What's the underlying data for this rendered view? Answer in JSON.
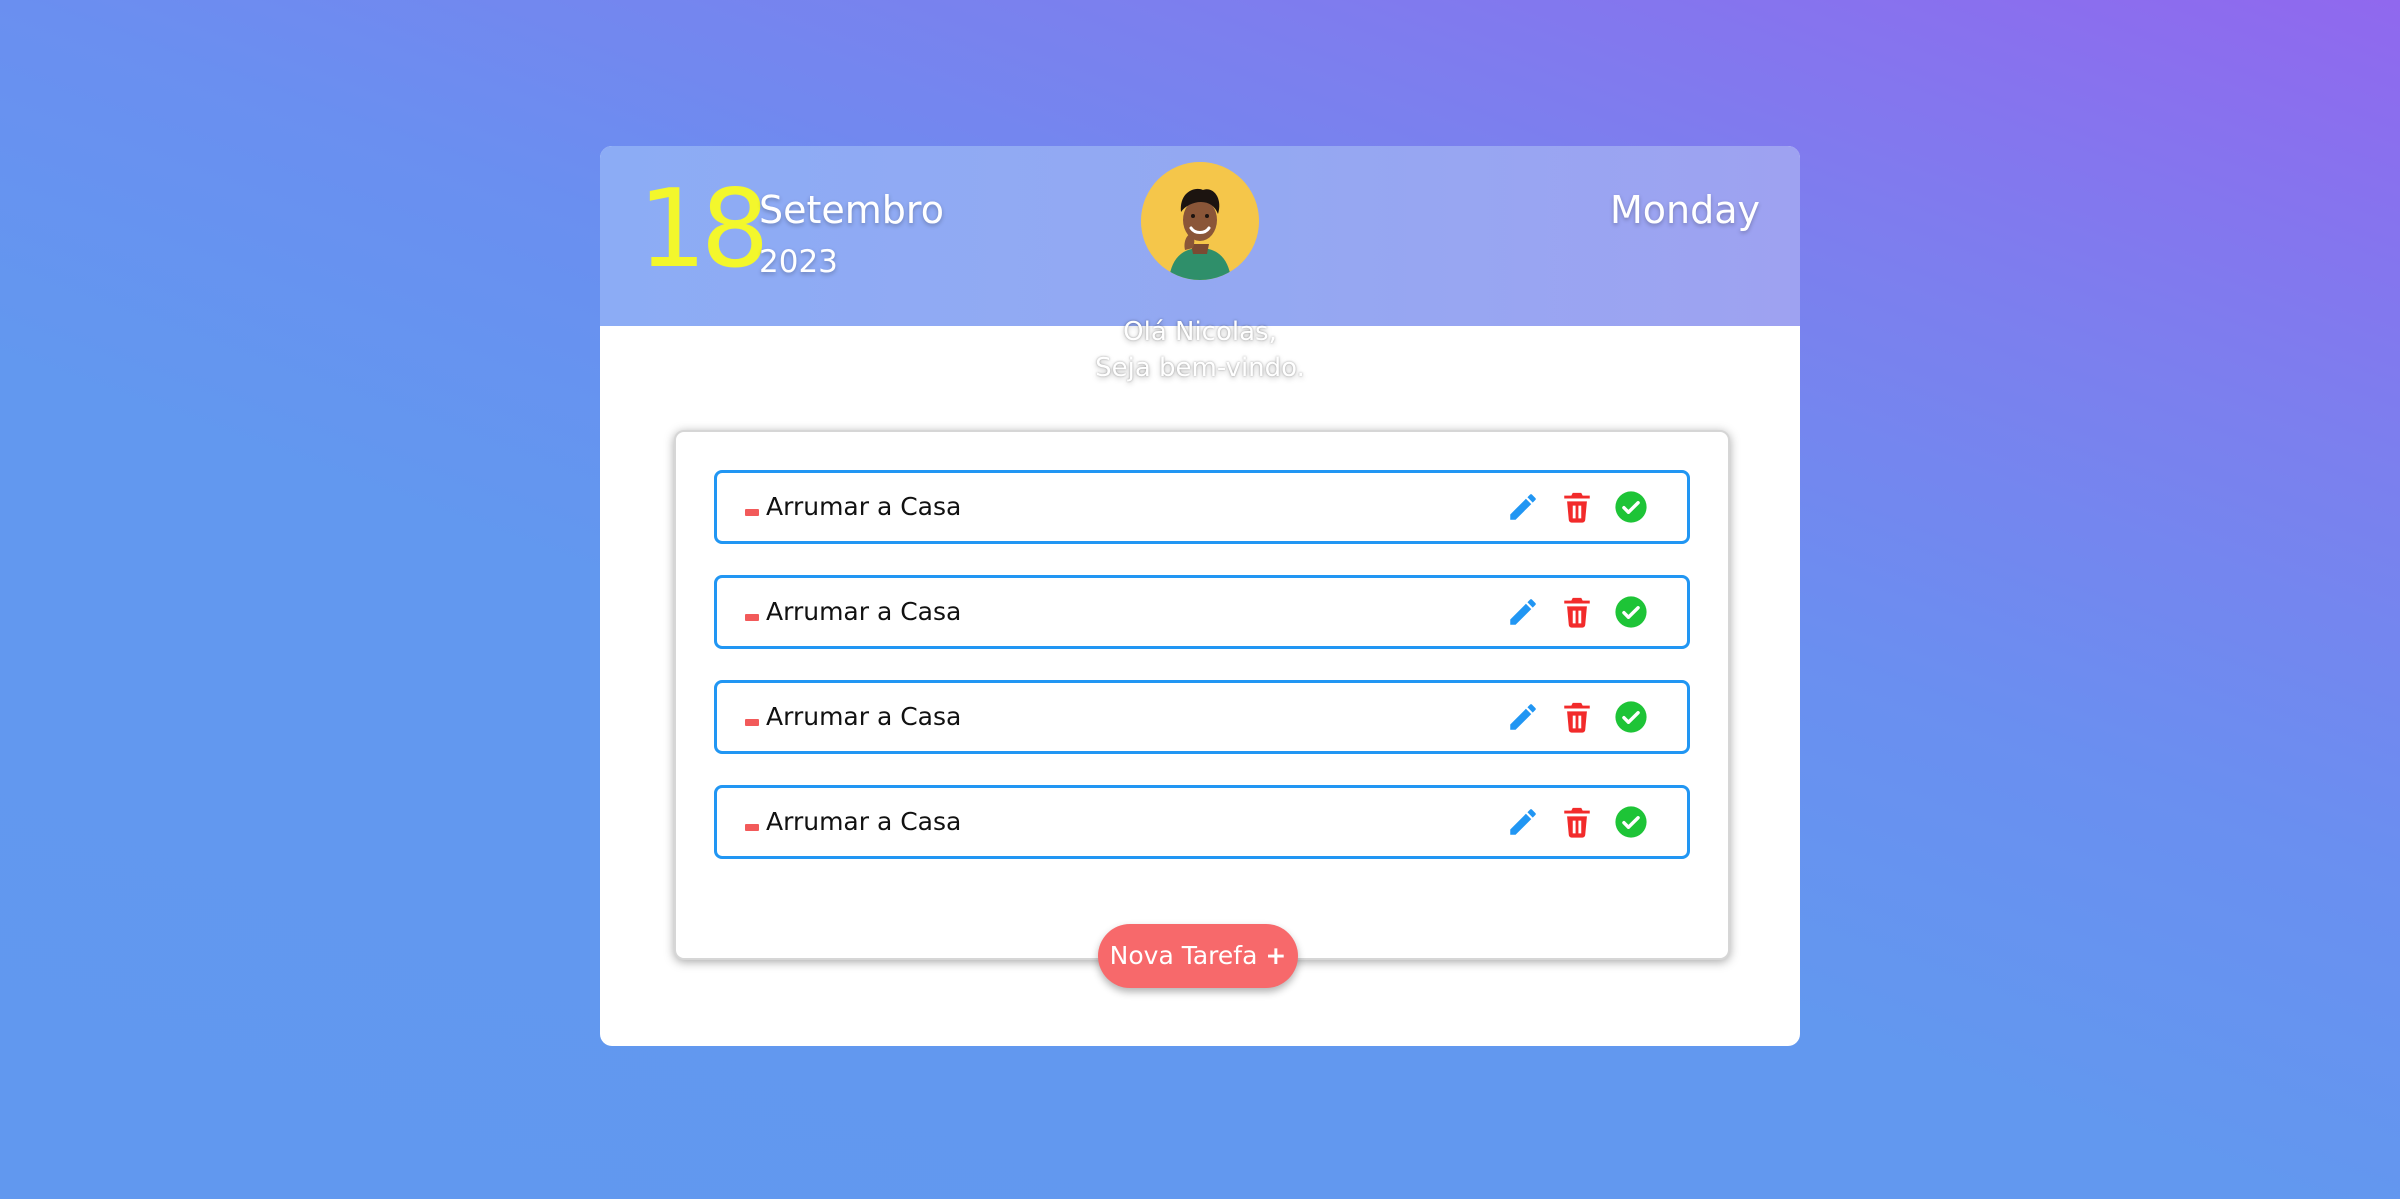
{
  "header": {
    "day": "18",
    "month": "Setembro",
    "year": "2023",
    "weekday": "Monday"
  },
  "greeting": {
    "line1": "Olá Nicolas,",
    "line2": "Seja bem-vindo."
  },
  "tasks": [
    {
      "title": "Arrumar a Casa"
    },
    {
      "title": "Arrumar a Casa"
    },
    {
      "title": "Arrumar a Casa"
    },
    {
      "title": "Arrumar a Casa"
    }
  ],
  "new_task_button": {
    "label": "Nova Tarefa",
    "icon": "+"
  },
  "colors": {
    "day_number": "#f3f72c",
    "task_border": "#2196f3",
    "edit_icon": "#2196f3",
    "delete_icon": "#f22b2b",
    "done_icon": "#1ec437",
    "button": "#f7696b",
    "priority_mark": "#f25a5a"
  },
  "icons": {
    "avatar": "user-photo",
    "edit": "pencil-icon",
    "delete": "trash-icon",
    "done": "check-circle-icon"
  }
}
